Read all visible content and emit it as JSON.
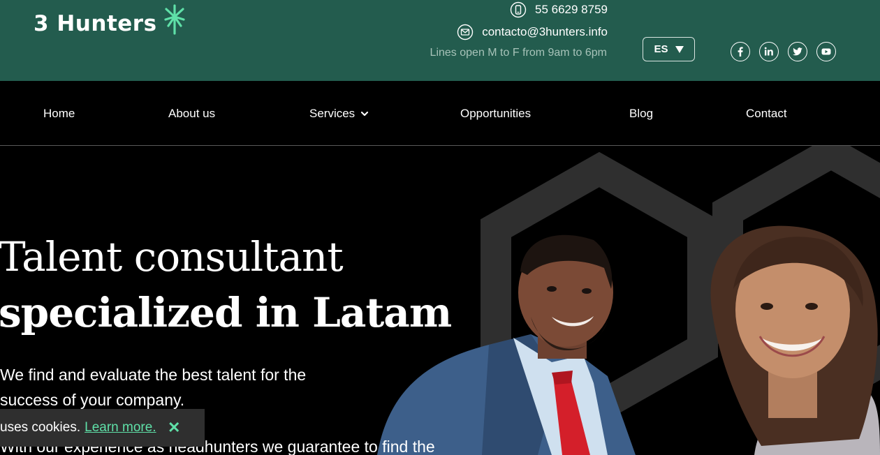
{
  "brand": {
    "name": "3 Hunters",
    "accent": "#5fe0a8",
    "topbar_color": "#235c4e"
  },
  "contact": {
    "phone": "55 6629 8759",
    "email": "contacto@3hunters.info",
    "hours": "Lines open M to F from 9am to 6pm"
  },
  "language": {
    "label": "ES"
  },
  "social": [
    "facebook-icon",
    "linkedin-icon",
    "twitter-icon",
    "youtube-icon"
  ],
  "nav": {
    "items": [
      "Home",
      "About us",
      "Services",
      "Opportunities",
      "Blog",
      "Contact"
    ]
  },
  "hero": {
    "title_line1": "Talent consultant",
    "title_line2": "specialized in Latam",
    "subtitle": "We find and evaluate the best talent for the success of your company.",
    "subtitle2": "With our experience as headhunters we guarantee to find the"
  },
  "cookie": {
    "text": "uses cookies.",
    "link": "Learn more.",
    "close": "✕"
  }
}
